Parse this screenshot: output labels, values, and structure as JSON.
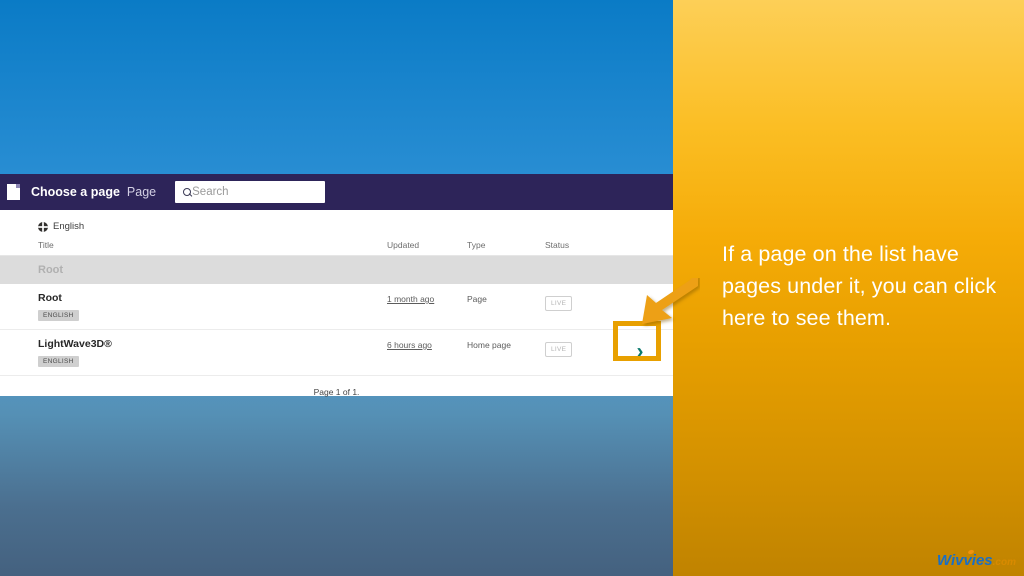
{
  "annotation": {
    "text": "If a page on the list have pages under it, you can click here to see them."
  },
  "watermark": {
    "main": "Wivvies",
    "tld": ".com"
  },
  "app": {
    "header": {
      "icon": "page-icon",
      "title": "Choose a page",
      "subtitle": "Page",
      "search": {
        "icon": "search-icon",
        "placeholder": "Search",
        "value": ""
      }
    },
    "language": {
      "icon": "globe-icon",
      "label": "English"
    },
    "table": {
      "columns": [
        "Title",
        "Updated",
        "Type",
        "Status"
      ],
      "breadcrumb": "Root",
      "rows": [
        {
          "title": "Root",
          "lang_badge": "ENGLISH",
          "updated": "1 month ago",
          "type": "Page",
          "status": "LIVE",
          "chevron": ""
        },
        {
          "title": "LightWave3D®",
          "lang_badge": "ENGLISH",
          "updated": "6 hours ago",
          "type": "Home page",
          "status": "LIVE",
          "chevron": "›"
        }
      ]
    },
    "pagination": "Page 1 of 1."
  },
  "colors": {
    "header_bar": "#2d2459",
    "highlight": "#e8a000",
    "chevron": "#0b7a6e",
    "panel_orange_top": "#fdcf57",
    "panel_orange_bottom": "#c08300",
    "background_blue": "#0a7bc6"
  }
}
